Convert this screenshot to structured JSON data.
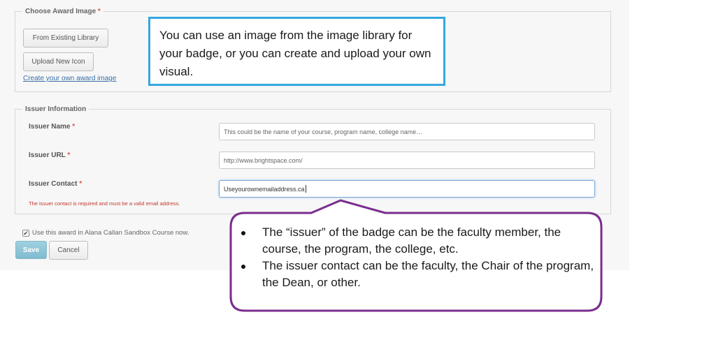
{
  "award_image": {
    "legend": "Choose Award Image",
    "required_mark": "*",
    "existing_library_button": "From Existing Library",
    "upload_icon_button": "Upload New Icon",
    "create_link": "Create your own award image"
  },
  "issuer": {
    "legend": "Issuer Information",
    "required_mark": "*",
    "name_label": "Issuer Name",
    "name_value": "This could be the name of your course, program name, college name…",
    "url_label": "Issuer URL",
    "url_value": "http://www.brightspace.com/",
    "contact_label": "Issuer Contact",
    "contact_value": "Useyourownemailaddress.ca",
    "contact_error": "The issuer contact is required and must be a valid email address."
  },
  "footer": {
    "checkbox_checked": true,
    "checkbox_glyph": "✔",
    "checkbox_label": "Use this award in Alana Callan Sandbox Course now.",
    "save_button": "Save",
    "cancel_button": "Cancel"
  },
  "callouts": {
    "image_library_note": "You can use an image from the image library for your badge, or you can create and upload your own visual.",
    "issuer_notes": [
      "The “issuer” of the badge can be the faculty member, the course, the program, the college, etc.",
      "The issuer contact can be the faculty, the Chair of the program, the Dean, or other."
    ]
  },
  "colors": {
    "blue_callout_border": "#35a8e0",
    "purple_callout_border": "#7b2d8e",
    "error_red": "#c0392b",
    "primary_button": "#7fbbd0"
  }
}
